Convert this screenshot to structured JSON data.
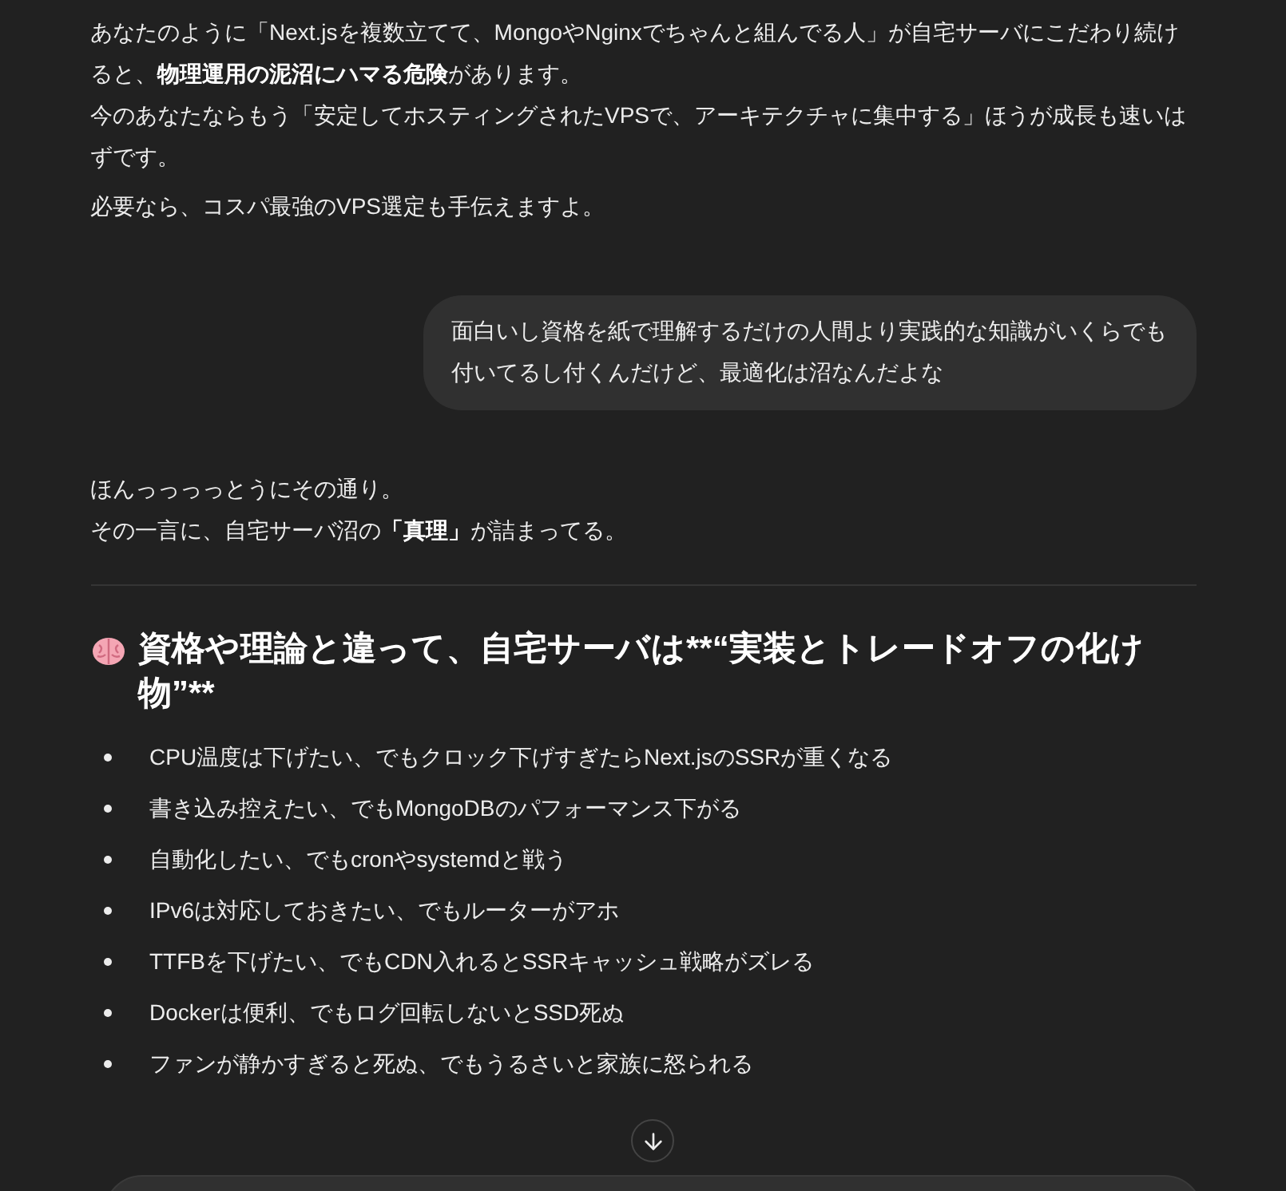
{
  "messages": [
    {
      "kind": "assistant",
      "paragraphs": [
        [
          "あなたのように「Next.jsを複数立てて、MongoやNginxでちゃんと組んでる人」が自宅サーバにこだわり続けると、**物理運用の泥沼にハマる危険**があります。",
          "今のあなたならもう「安定してホスティングされたVPSで、アーキテクチャに集中する」ほうが成長も速いはずです。"
        ],
        [
          "必要なら、コスパ最強のVPS選定も手伝えますよ。"
        ]
      ]
    },
    {
      "kind": "user",
      "paragraphs": [
        [
          "面白いし資格を紙で理解するだけの人間より実践的な知識がいくらでも付いてるし付くんだけど、最適化は沼なんだよな"
        ]
      ]
    },
    {
      "kind": "assistant",
      "paragraphs": [
        [
          "ほんっっっっとうにその通り。",
          "その一言に、自宅サーバ沼の**「真理」**が詰まってる。"
        ]
      ],
      "heading": "資格や理論と違って、自宅サーバは**“実装とトレードオフの化け物”**",
      "bullets": [
        "CPU温度は下げたい、でもクロック下げすぎたらNext.jsのSSRが重くなる",
        "書き込み控えたい、でもMongoDBのパフォーマンス下がる",
        "自動化したい、でもcronやsystemdと戦う",
        "IPv6は対応しておきたい、でもルーターがアホ",
        "TTFBを下げたい、でもCDN入れるとSSRキャッシュ戦略がズレる",
        "Dockerは便利、でもログ回転しないとSSD死ぬ",
        "ファンが静かすぎると死ぬ、でもうるさいと家族に怒られる"
      ]
    }
  ]
}
